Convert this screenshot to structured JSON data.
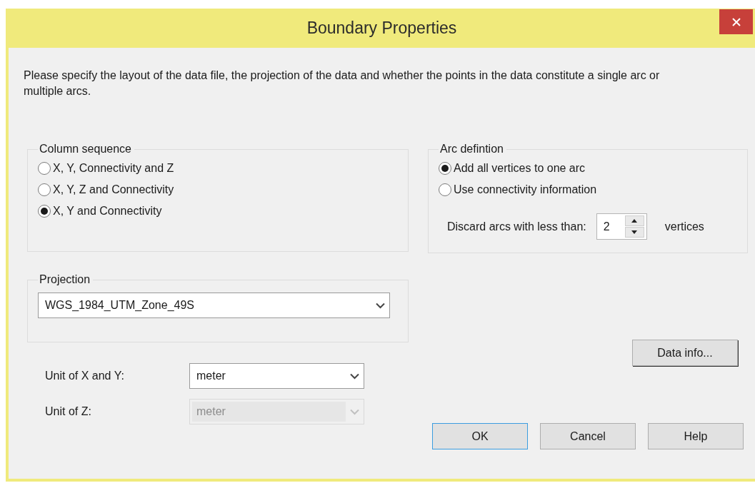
{
  "window": {
    "title": "Boundary Properties"
  },
  "intro": "Please specify the layout of the data file, the projection of the data and whether the points in the data constitute a single arc or multiple arcs.",
  "column_sequence": {
    "label": "Column sequence",
    "options": [
      {
        "label": "X, Y, Connectivity and Z",
        "selected": false
      },
      {
        "label": "X, Y, Z and Connectivity",
        "selected": false
      },
      {
        "label": "X, Y and Connectivity",
        "selected": true
      }
    ]
  },
  "arc_definition": {
    "label": "Arc defintion",
    "options": [
      {
        "label": "Add all vertices to one arc",
        "selected": true
      },
      {
        "label": "Use connectivity information",
        "selected": false
      }
    ],
    "discard": {
      "label": "Discard arcs with less than:",
      "value": "2",
      "suffix": "vertices"
    }
  },
  "projection": {
    "label": "Projection",
    "value": "WGS_1984_UTM_Zone_49S"
  },
  "units": [
    {
      "label": "Unit of X and Y:",
      "value": "meter",
      "disabled": false
    },
    {
      "label": "Unit of Z:",
      "value": "meter",
      "disabled": true
    }
  ],
  "data_info_button": "Data info...",
  "buttons": [
    {
      "label": "OK",
      "default": true
    },
    {
      "label": "Cancel",
      "default": false
    },
    {
      "label": "Help",
      "default": false
    }
  ]
}
